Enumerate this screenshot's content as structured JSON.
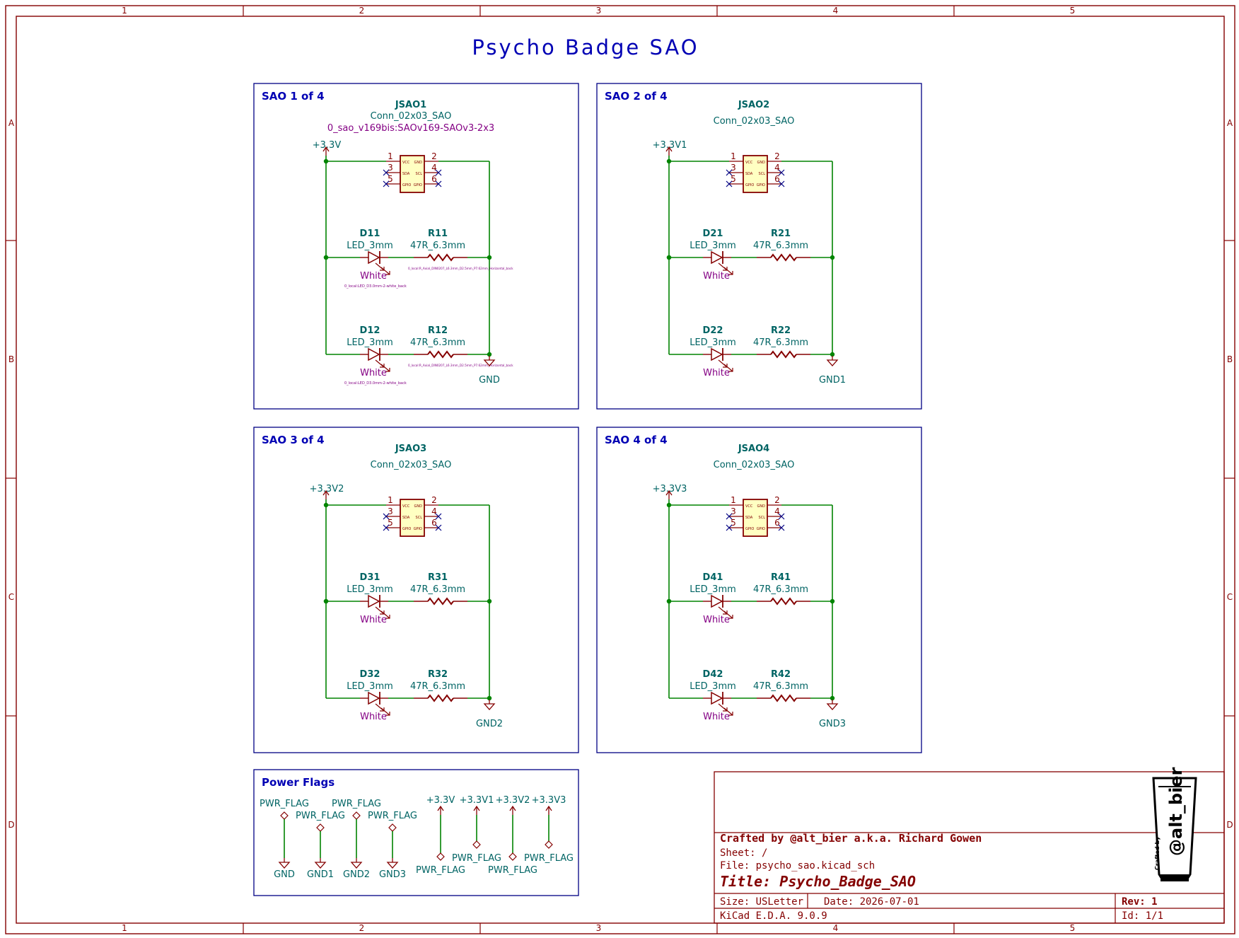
{
  "colors": {
    "border": "#840000",
    "wire": "#008400",
    "junction": "#008400",
    "ref_text": "#006464",
    "value_text": "#006464",
    "footprint_text": "#840084",
    "sheet_title": "#0000b4",
    "box": "#000084",
    "pin": "#840000",
    "body_fill": "#ffffc2",
    "power": "#840000"
  },
  "frame": {
    "col_labels": [
      "1",
      "2",
      "3",
      "4",
      "5"
    ],
    "row_labels": [
      "A",
      "B",
      "C",
      "D"
    ]
  },
  "sheet_title": "Psycho Badge SAO",
  "blocks": [
    {
      "title": "SAO 1 of 4",
      "conn_ref": "JSAO1",
      "conn_value": "Conn_02x03_SAO",
      "conn_footprint": "0_sao_v169bis:SAOv169-SAOv3-2x3",
      "vcc_label": "+3.3V",
      "gnd_label": "GND",
      "d_top_ref": "D11",
      "d_top_value": "LED_3mm",
      "d_top_color": "White",
      "d_top_fp": "0_local:LED_D3.0mm-2-white_back",
      "r_top_ref": "R11",
      "r_top_value": "47R_6.3mm",
      "r_top_fp": "0_local:R_Axial_DIN0207_L6.3mm_D2.5mm_P7.62mm_Horizontal_back",
      "d_bot_ref": "D12",
      "d_bot_value": "LED_3mm",
      "d_bot_color": "White",
      "d_bot_fp": "0_local:LED_D3.0mm-2-white_back",
      "r_bot_ref": "R12",
      "r_bot_value": "47R_6.3mm",
      "r_bot_fp": "0_local:R_Axial_DIN0207_L6.3mm_D2.5mm_P7.62mm_Horizontal_back"
    },
    {
      "title": "SAO 2 of 4",
      "conn_ref": "JSAO2",
      "conn_value": "Conn_02x03_SAO",
      "vcc_label": "+3.3V1",
      "gnd_label": "GND1",
      "d_top_ref": "D21",
      "d_top_value": "LED_3mm",
      "d_top_color": "White",
      "r_top_ref": "R21",
      "r_top_value": "47R_6.3mm",
      "d_bot_ref": "D22",
      "d_bot_value": "LED_3mm",
      "d_bot_color": "White",
      "r_bot_ref": "R22",
      "r_bot_value": "47R_6.3mm"
    },
    {
      "title": "SAO 3 of 4",
      "conn_ref": "JSAO3",
      "conn_value": "Conn_02x03_SAO",
      "vcc_label": "+3.3V2",
      "gnd_label": "GND2",
      "d_top_ref": "D31",
      "d_top_value": "LED_3mm",
      "d_top_color": "White",
      "r_top_ref": "R31",
      "r_top_value": "47R_6.3mm",
      "d_bot_ref": "D32",
      "d_bot_value": "LED_3mm",
      "d_bot_color": "White",
      "r_bot_ref": "R32",
      "r_bot_value": "47R_6.3mm"
    },
    {
      "title": "SAO 4 of 4",
      "conn_ref": "JSAO4",
      "conn_value": "Conn_02x03_SAO",
      "vcc_label": "+3.3V3",
      "gnd_label": "GND3",
      "d_top_ref": "D41",
      "d_top_value": "LED_3mm",
      "d_top_color": "White",
      "r_top_ref": "R41",
      "r_top_value": "47R_6.3mm",
      "d_bot_ref": "D42",
      "d_bot_value": "LED_3mm",
      "d_bot_color": "White",
      "r_bot_ref": "R42",
      "r_bot_value": "47R_6.3mm"
    }
  ],
  "connector_pins": {
    "numbers": [
      "1",
      "2",
      "3",
      "4",
      "5",
      "6"
    ],
    "names": [
      "VCC",
      "GND",
      "SDA",
      "SCL",
      "GPIO",
      "GPIO"
    ]
  },
  "power_flags": {
    "title": "Power Flags",
    "flag_label": "PWR_FLAG",
    "gnd_nets": [
      "GND",
      "GND1",
      "GND2",
      "GND3"
    ],
    "vcc_nets": [
      "+3.3V",
      "+3.3V1",
      "+3.3V2",
      "+3.3V3"
    ]
  },
  "title_block": {
    "crafted": "Crafted by @alt_bier a.k.a. Richard Gowen",
    "sheet": "Sheet: /",
    "file": "File: psycho_sao.kicad_sch",
    "title": "Title: Psycho_Badge_SAO",
    "size": "Size: USLetter",
    "date": "Date: 2026-07-01",
    "rev": "Rev: 1",
    "kicad": "KiCad E.D.A. 9.0.9",
    "id": "Id: 1/1",
    "logo_text": "@alt_bier",
    "logo_small": "Crafted by"
  }
}
